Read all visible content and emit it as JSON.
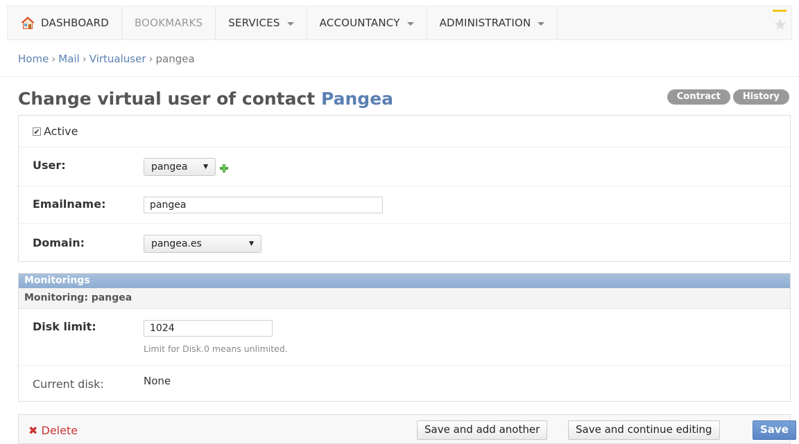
{
  "nav": {
    "items": [
      {
        "label": "DASHBOARD",
        "disabled": false,
        "dropdown": false
      },
      {
        "label": "BOOKMARKS",
        "disabled": true,
        "dropdown": false
      },
      {
        "label": "SERVICES",
        "disabled": false,
        "dropdown": true
      },
      {
        "label": "ACCOUNTANCY",
        "disabled": false,
        "dropdown": true
      },
      {
        "label": "ADMINISTRATION",
        "disabled": false,
        "dropdown": true
      }
    ],
    "home_icon": "home-icon",
    "star_icon": "star-icon"
  },
  "breadcrumb": {
    "items": [
      "Home",
      "Mail",
      "Virtualuser"
    ],
    "separator": "›",
    "current": "pangea"
  },
  "page": {
    "title_prefix": "Change virtual user of contact",
    "title_accent": "Pangea"
  },
  "object_tools": {
    "contract": "Contract",
    "history": "History"
  },
  "form": {
    "active_label": "Active",
    "active_checked": true,
    "user_label": "User:",
    "user_value": "pangea",
    "emailname_label": "Emailname:",
    "emailname_value": "pangea",
    "domain_label": "Domain:",
    "domain_value": "pangea.es"
  },
  "monitorings": {
    "heading": "Monitorings",
    "subheading": "Monitoring: pangea",
    "disk_limit_label": "Disk limit:",
    "disk_limit_value": "1024",
    "disk_limit_help": "Limit for Disk.0 means unlimited.",
    "current_disk_label": "Current disk:",
    "current_disk_value": "None"
  },
  "submit": {
    "delete": "Delete",
    "save_add_another": "Save and add another",
    "save_continue": "Save and continue editing",
    "save": "Save"
  },
  "colors": {
    "link": "#5b80b2",
    "delete": "#cc3434",
    "primary_button": "#5b86c5",
    "inline_header": "#8eaed2"
  }
}
